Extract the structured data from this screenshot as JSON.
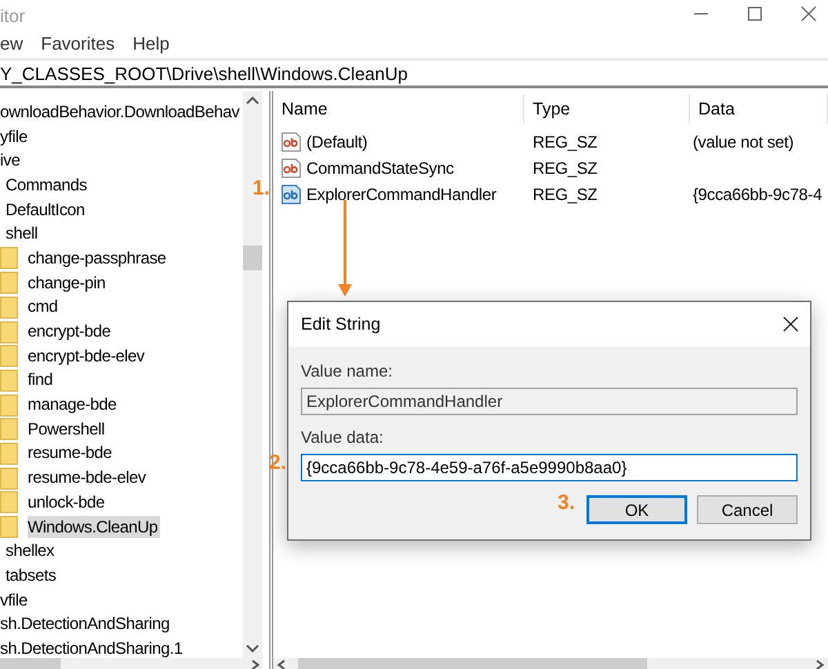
{
  "window": {
    "title": "itor",
    "menu": [
      "ew",
      "Favorites",
      "Help"
    ],
    "address": "Y_CLASSES_ROOT\\Drive\\shell\\Windows.CleanUp"
  },
  "tree": {
    "items": [
      {
        "label": "ownloadBehavior.DownloadBehav",
        "selected": false
      },
      {
        "label": "yfile",
        "selected": false
      },
      {
        "label": "ive",
        "selected": false,
        "children": [
          {
            "label": "Commands",
            "selected": false
          },
          {
            "label": "DefaultIcon",
            "selected": false
          },
          {
            "label": "shell",
            "selected": false,
            "children": [
              {
                "label": "change-passphrase",
                "selected": false
              },
              {
                "label": "change-pin",
                "selected": false
              },
              {
                "label": "cmd",
                "selected": false
              },
              {
                "label": "encrypt-bde",
                "selected": false
              },
              {
                "label": "encrypt-bde-elev",
                "selected": false
              },
              {
                "label": "find",
                "selected": false
              },
              {
                "label": "manage-bde",
                "selected": false
              },
              {
                "label": "Powershell",
                "selected": false
              },
              {
                "label": "resume-bde",
                "selected": false
              },
              {
                "label": "resume-bde-elev",
                "selected": false
              },
              {
                "label": "unlock-bde",
                "selected": false
              },
              {
                "label": "Windows.CleanUp",
                "selected": true
              }
            ]
          },
          {
            "label": "shellex",
            "selected": false
          },
          {
            "label": "tabsets",
            "selected": false
          }
        ]
      },
      {
        "label": "vfile",
        "selected": false
      },
      {
        "label": "sh.DetectionAndSharing",
        "selected": false
      },
      {
        "label": "sh.DetectionAndSharing.1",
        "selected": false
      }
    ]
  },
  "values": {
    "columns": [
      "Name",
      "Type",
      "Data"
    ],
    "rows": [
      {
        "name": "(Default)",
        "type": "REG_SZ",
        "data": "(value not set)",
        "selected": false
      },
      {
        "name": "CommandStateSync",
        "type": "REG_SZ",
        "selected": false
      },
      {
        "name": "ExplorerCommandHandler",
        "type": "REG_SZ",
        "data": "{9cca66bb-9c78-4",
        "selected": true
      }
    ]
  },
  "dialog": {
    "title": "Edit String",
    "fields": [
      {
        "label": "Value name:",
        "value": "ExplorerCommandHandler",
        "disabled": true
      },
      {
        "label": "Value data:",
        "value": "{9cca66bb-9c78-4e59-a76f-a5e9990b8aa0}",
        "disabled": false
      }
    ],
    "buttons": [
      {
        "label": "OK",
        "default": true
      },
      {
        "label": "Cancel",
        "default": false
      }
    ]
  },
  "annotations": [
    {
      "text": "1."
    },
    {
      "text": "2."
    },
    {
      "text": "3."
    }
  ]
}
